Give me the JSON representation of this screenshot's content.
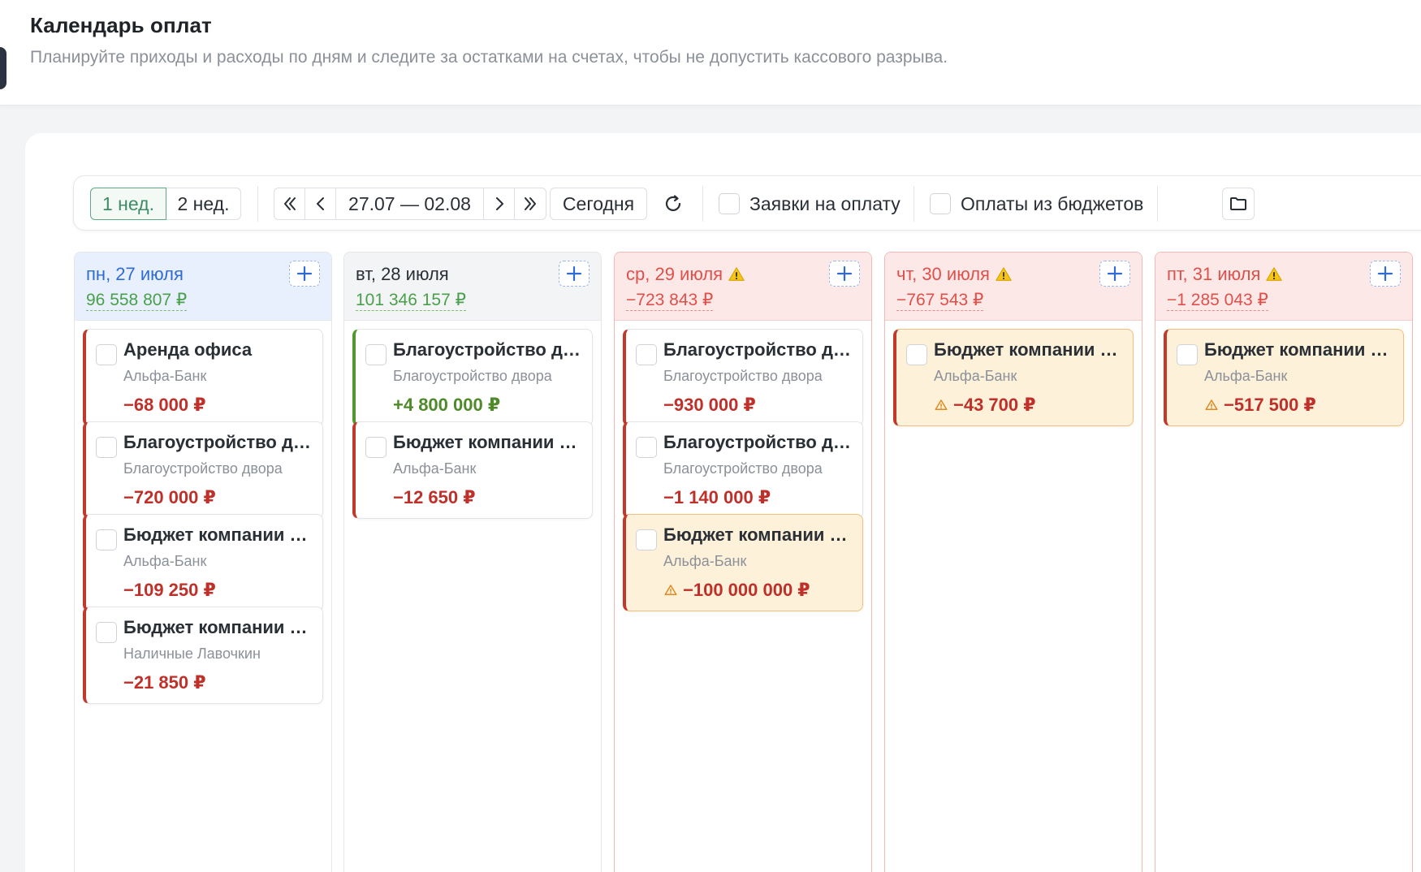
{
  "header": {
    "title": "Календарь оплат",
    "subtitle": "Планируйте приходы и расходы по дням и следите за остатками на счетах, чтобы не допустить кассового разрыва."
  },
  "toolbar": {
    "week1": "1 нед.",
    "week2": "2 нед.",
    "range": "27.07 — 02.08",
    "today": "Сегодня",
    "requests_label": "Заявки на оплату",
    "budgets_label": "Оплаты из бюджетов"
  },
  "icons": {
    "first": "double-chevron-left-icon",
    "prev": "chevron-left-icon",
    "next": "chevron-right-icon",
    "last": "double-chevron-right-icon",
    "refresh": "refresh-icon",
    "folder": "folder-icon",
    "add": "plus-icon",
    "warning": "warning-icon"
  },
  "colors": {
    "expense": "#c0302a",
    "income": "#4e8a2a",
    "alert": "#e0504a",
    "accent": "#2f6bd4",
    "active_segment": "#3e8c66"
  },
  "days": [
    {
      "date": "пн, 27 июля",
      "balance": "96 558 807 ₽",
      "state": "today",
      "payments": [
        {
          "title": "Аренда офиса",
          "account": "Альфа-Банк",
          "amount": "−68 000 ₽",
          "kind": "expense"
        },
        {
          "title": "Благоустройство двора",
          "account": "Благоустройство двора",
          "amount": "−720 000 ₽",
          "kind": "expense"
        },
        {
          "title": "Бюджет компании ООО",
          "account": "Альфа-Банк",
          "amount": "−109 250 ₽",
          "kind": "expense"
        },
        {
          "title": "Бюджет компании ООО",
          "account": "Наличные Лавочкин",
          "amount": "−21 850 ₽",
          "kind": "expense"
        }
      ]
    },
    {
      "date": "вт, 28 июля",
      "balance": "101 346 157 ₽",
      "state": "normal",
      "payments": [
        {
          "title": "Благоустройство двора",
          "account": "Благоустройство двора",
          "amount": "+4 800 000 ₽",
          "kind": "income"
        },
        {
          "title": "Бюджет компании ООО",
          "account": "Альфа-Банк",
          "amount": "−12 650 ₽",
          "kind": "expense"
        }
      ]
    },
    {
      "date": "ср, 29 июля",
      "balance": "−723 843 ₽",
      "state": "negative",
      "payments": [
        {
          "title": "Благоустройство двора",
          "account": "Благоустройство двора",
          "amount": "−930 000 ₽",
          "kind": "expense"
        },
        {
          "title": "Благоустройство двора",
          "account": "Благоустройство двора",
          "amount": "−1 140 000 ₽",
          "kind": "expense"
        },
        {
          "title": "Бюджет компании ООО",
          "account": "Альфа-Банк",
          "amount": "−100 000 000 ₽",
          "kind": "warn"
        }
      ]
    },
    {
      "date": "чт, 30 июля",
      "balance": "−767 543 ₽",
      "state": "negative",
      "payments": [
        {
          "title": "Бюджет компании ООО",
          "account": "Альфа-Банк",
          "amount": "−43 700 ₽",
          "kind": "warn"
        }
      ]
    },
    {
      "date": "пт, 31 июля",
      "balance": "−1 285 043 ₽",
      "state": "negative",
      "payments": [
        {
          "title": "Бюджет компании ООО",
          "account": "Альфа-Банк",
          "amount": "−517 500 ₽",
          "kind": "warn"
        }
      ]
    }
  ]
}
